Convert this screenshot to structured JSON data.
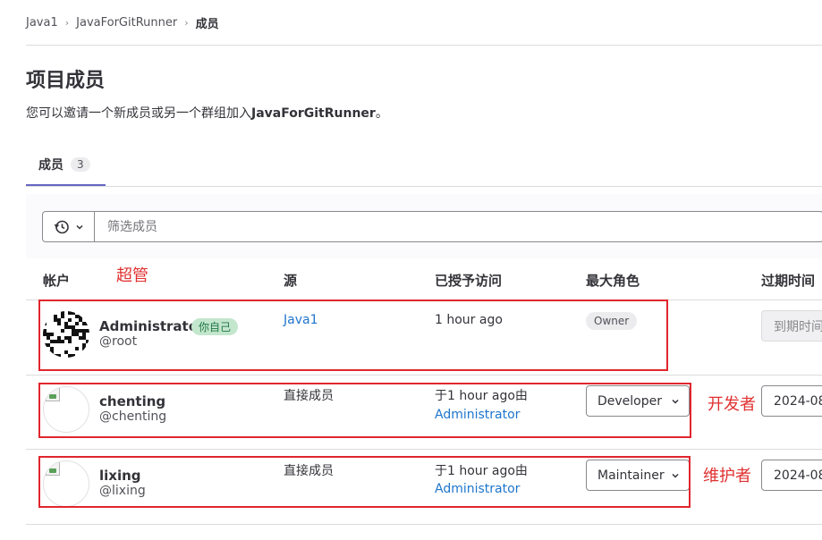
{
  "breadcrumb": {
    "items": [
      "Java1",
      "JavaForGitRunner"
    ],
    "current": "成员"
  },
  "page": {
    "title": "项目成员",
    "subtitle_prefix": "您可以邀请一个新成员或另一个群组加入",
    "subtitle_project": "JavaForGitRunner",
    "subtitle_suffix": "。"
  },
  "tabs": [
    {
      "label": "成员",
      "count": "3"
    }
  ],
  "filter": {
    "placeholder": "筛选成员"
  },
  "table": {
    "headers": {
      "account": "帐户",
      "source": "源",
      "granted": "已授予访问",
      "max_role": "最大角色",
      "expiration": "过期时间"
    }
  },
  "annotations": {
    "admin": "超管",
    "developer": "开发者",
    "maintainer": "维护者"
  },
  "members": [
    {
      "name": "Administrator",
      "username": "@root",
      "you_badge": "你自己",
      "source": "Java1",
      "granted": "1 hour ago",
      "role": "Owner",
      "expiration": "到期时间"
    },
    {
      "name": "chenting",
      "username": "@chenting",
      "source": "直接成员",
      "granted": "于1 hour ago由",
      "granted_by": "Administrator",
      "role": "Developer",
      "expiration": "2024-08"
    },
    {
      "name": "lixing",
      "username": "@lixing",
      "source": "直接成员",
      "granted": "于1 hour ago由",
      "granted_by": "Administrator",
      "role": "Maintainer",
      "expiration": "2024-08"
    }
  ],
  "colors": {
    "accent": "#6666c4",
    "link": "#1f75cb",
    "annotation": "#e0262e",
    "you_badge_bg": "#c3e6cd"
  }
}
